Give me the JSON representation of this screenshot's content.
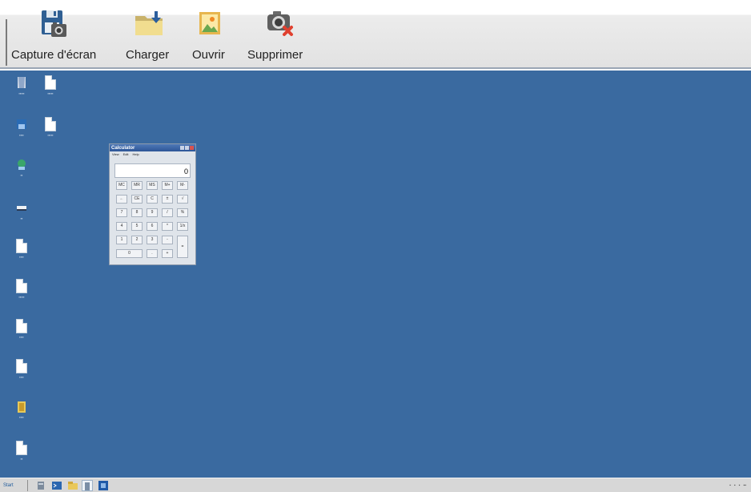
{
  "toolbar": {
    "buttons": [
      {
        "id": "capture",
        "label": "Capture d'écran",
        "icon": "floppy-camera-icon"
      },
      {
        "id": "load",
        "label": "Charger",
        "icon": "folder-download-icon"
      },
      {
        "id": "open",
        "label": "Ouvrir",
        "icon": "picture-icon"
      },
      {
        "id": "delete",
        "label": "Supprimer",
        "icon": "camera-delete-icon"
      }
    ]
  },
  "desktop": {
    "background": "#3a6aa0",
    "calculator": {
      "title": "Calculator",
      "menu": [
        "View",
        "Edit",
        "Help"
      ],
      "display": "0",
      "keys": [
        "MC",
        "MR",
        "MS",
        "M+",
        "M-",
        "←",
        "CE",
        "C",
        "±",
        "√",
        "7",
        "8",
        "9",
        "/",
        "%",
        "4",
        "5",
        "6",
        "*",
        "1/x",
        "1",
        "2",
        "3",
        "-",
        "=",
        "0",
        ".",
        "+"
      ]
    }
  },
  "taskbar": {
    "start_label": "Start"
  }
}
